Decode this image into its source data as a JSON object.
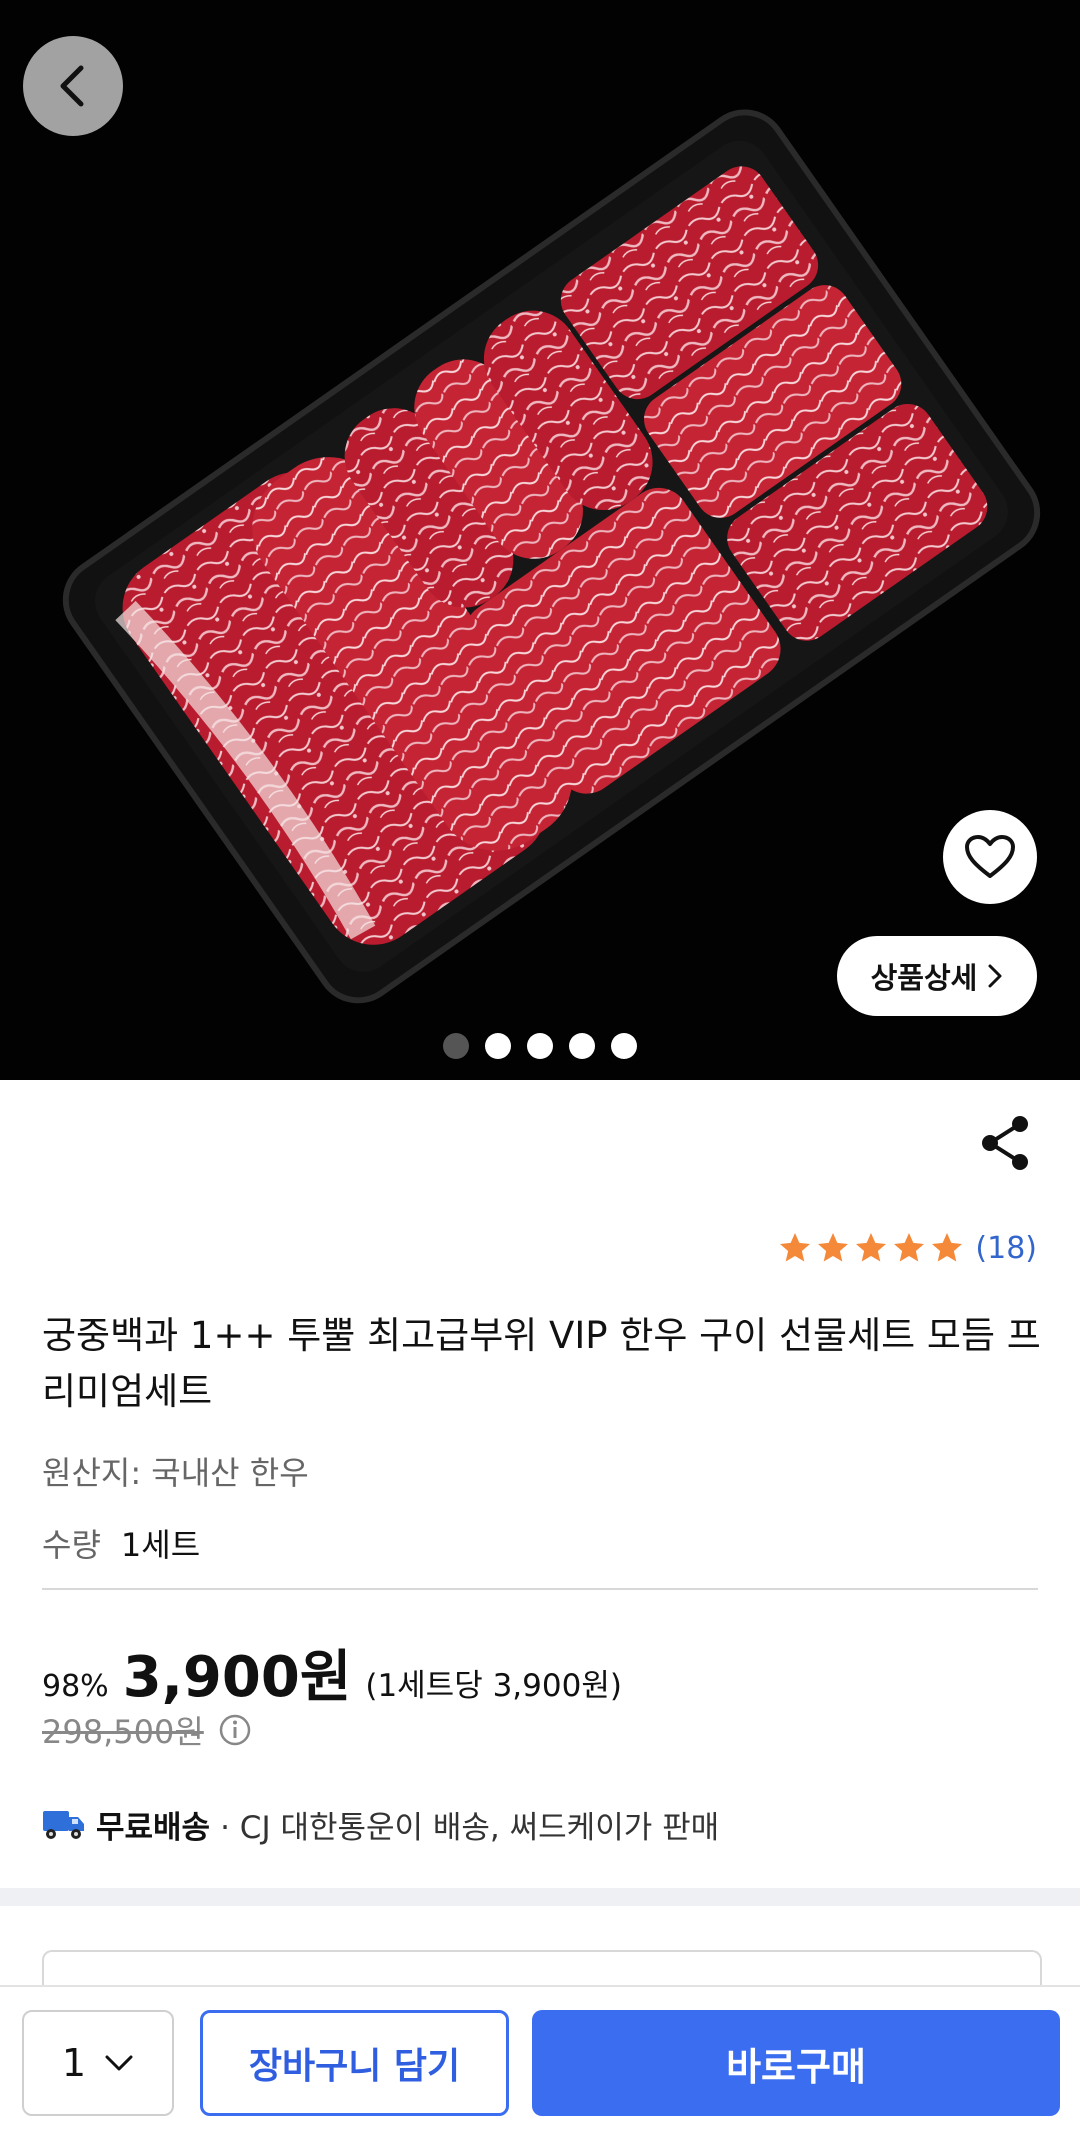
{
  "hero": {
    "image_alt": "hanwoo beef set on black tray",
    "back_icon": "chevron-left-icon",
    "wish_icon": "heart-icon",
    "detail_label": "상품상세",
    "detail_icon": "chevron-right-icon",
    "slide_count": 5,
    "active_slide": 1
  },
  "product": {
    "share_icon": "share-icon",
    "rating_stars": 5,
    "review_count": "(18)",
    "title": "궁중백과 1++ 투뿔 최고급부위 VIP 한우 구이 선물세트 모듬 프리미엄세트",
    "origin": "원산지: 국내산 한우",
    "qty_label": "수량",
    "qty_value": "1세트",
    "discount": "98%",
    "price": "3,900원",
    "unit_price": "(1세트당 3,900원)",
    "original_price": "298,500원",
    "info_icon": "info-icon",
    "shipping_icon": "truck-icon",
    "shipping_free": "무료배송",
    "shipping_desc": "· CJ 대한통운이 배송, 써드케이가 판매"
  },
  "bottom_bar": {
    "quantity": "1",
    "cart_label": "장바구니 담기",
    "buy_label": "바로구매"
  },
  "colors": {
    "accent": "#3a6df0",
    "star": "#f5893a",
    "review_count": "#3366cc"
  }
}
